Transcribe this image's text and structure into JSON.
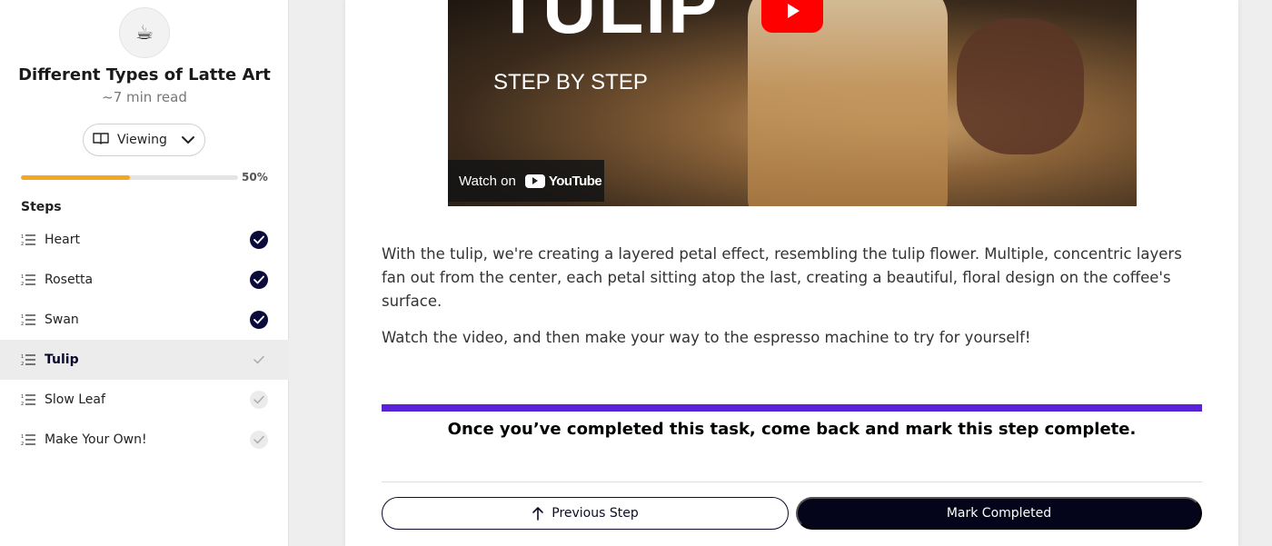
{
  "sidebar": {
    "logo_icon": "coffee-cup-icon",
    "title": "Different Types of Latte Art",
    "read_time": "~7 min read",
    "view_mode": {
      "label": "Viewing",
      "icon": "book-open-icon"
    },
    "progress": {
      "percent": 50,
      "label": "50%",
      "color": "#f5a623"
    },
    "steps_title": "Steps",
    "steps": [
      {
        "label": "Heart",
        "status": "completed"
      },
      {
        "label": "Rosetta",
        "status": "completed"
      },
      {
        "label": "Swan",
        "status": "completed"
      },
      {
        "label": "Tulip",
        "status": "current"
      },
      {
        "label": "Slow Leaf",
        "status": "pending"
      },
      {
        "label": "Make Your Own!",
        "status": "pending"
      }
    ]
  },
  "video": {
    "headline": "TULIP",
    "subheadline": "STEP BY STEP",
    "watch_on": "Watch on",
    "brand": "YouTube"
  },
  "content": {
    "paragraph_1": "With the tulip, we're creating a layered petal effect, resembling the tulip flower. Multiple, concentric layers fan out from the center, each petal sitting atop the last, creating a beautiful, floral design on the coffee's surface.",
    "paragraph_2": "Watch the video, and then make your way to the espresso machine to try for yourself!",
    "banner": "Once you’ve completed this task, come back and mark this step complete.",
    "banner_color": "#5a22d6"
  },
  "actions": {
    "previous_label": "Previous Step",
    "complete_label": "Mark Completed"
  }
}
